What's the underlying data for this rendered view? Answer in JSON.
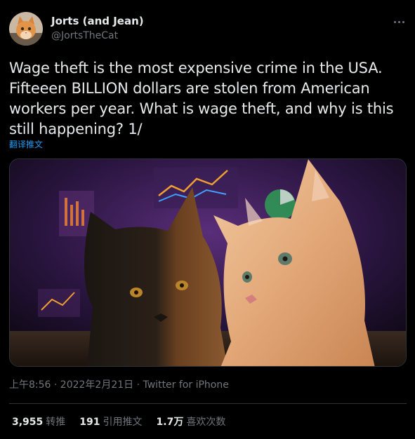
{
  "author": {
    "display_name": "Jorts (and Jean)",
    "handle": "@JortsTheCat",
    "avatar_icon": "orange-cat-avatar-icon"
  },
  "tweet": {
    "text": "Wage theft is the most expensive crime in the USA. Fifteeen BILLION dollars are stolen from American workers per year. What is wage theft, and why is this still happening? 1/",
    "translate_label": "翻译推文",
    "media_icon": "two-cats-photo-image",
    "timestamp": "上午8:56 · 2022年2月21日 · ",
    "source": "Twitter for iPhone"
  },
  "stats": {
    "retweets": {
      "count": "3,955",
      "label": "转推"
    },
    "quotes": {
      "count": "191",
      "label": "引用推文"
    },
    "likes": {
      "count": "1.7万",
      "label": "喜欢次数"
    }
  },
  "colors": {
    "background": "#000000",
    "text": "#e7e9ea",
    "secondary": "#71767b",
    "link": "#1d9bf0",
    "border": "#2f3336"
  }
}
